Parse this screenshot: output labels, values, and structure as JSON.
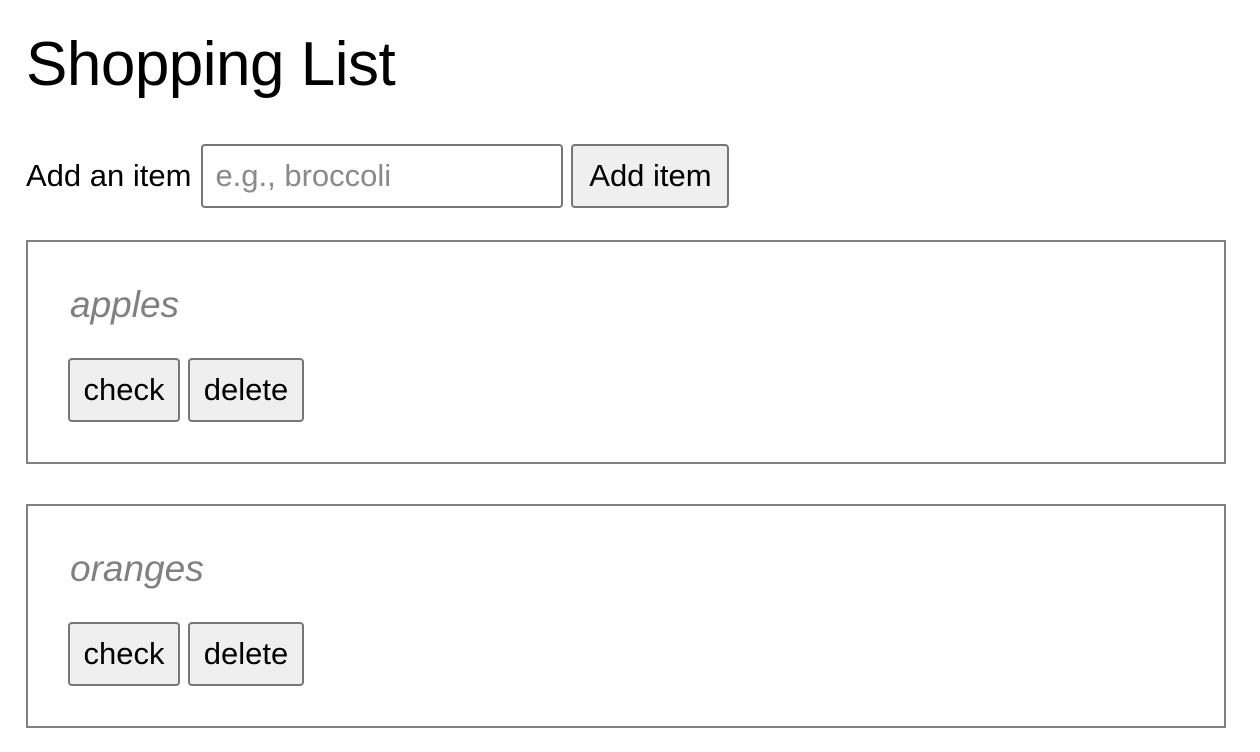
{
  "header": {
    "title": "Shopping List"
  },
  "add_form": {
    "label": "Add an item",
    "input_value": "",
    "input_placeholder": "e.g., broccoli",
    "button_label": "Add item"
  },
  "items": [
    {
      "name": "apples",
      "check_label": "check",
      "delete_label": "delete"
    },
    {
      "name": "oranges",
      "check_label": "check",
      "delete_label": "delete"
    }
  ],
  "colors": {
    "text": "#000000",
    "muted_item_text": "#808080",
    "border": "#767676",
    "button_background": "#efefef",
    "background": "#ffffff"
  }
}
